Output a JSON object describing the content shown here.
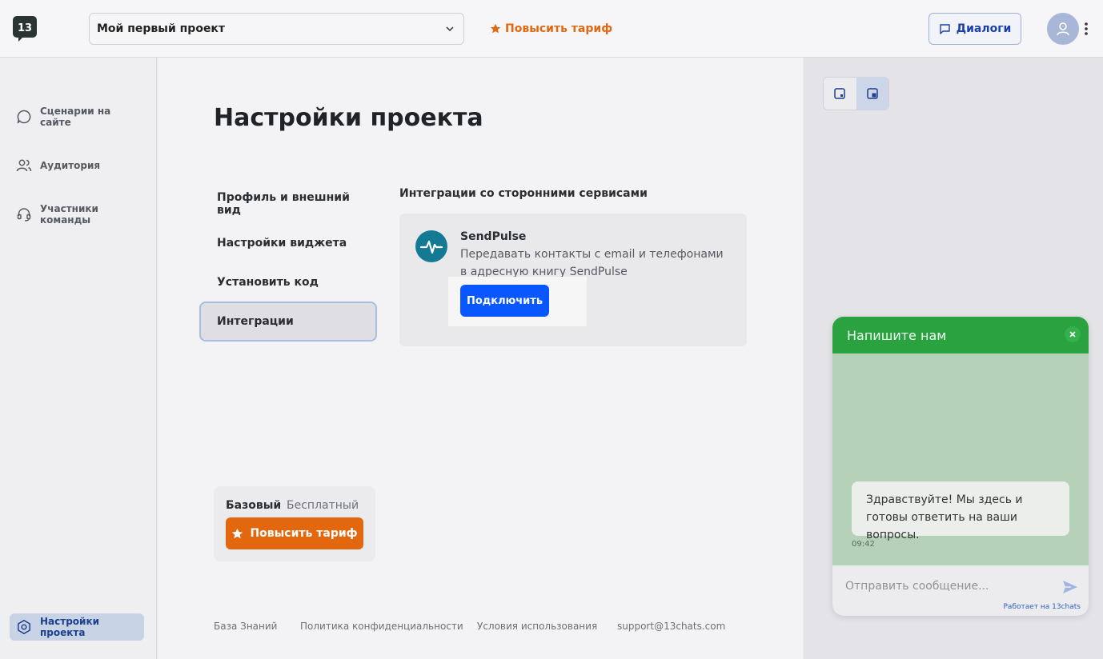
{
  "header": {
    "project_select": "Мой первый проект",
    "upgrade_link": "Повысить тариф",
    "dialogs_button": "Диалоги"
  },
  "sidebar": {
    "items": [
      {
        "label": "Сценарии на сайте",
        "icon": "chat-bubble-icon"
      },
      {
        "label": "Аудитория",
        "icon": "users-icon"
      },
      {
        "label": "Участники команды",
        "icon": "headset-icon"
      }
    ],
    "active_item": {
      "label": "Настройки проекта",
      "icon": "hexagon-settings-icon"
    }
  },
  "main": {
    "title": "Настройки проекта",
    "nav": [
      {
        "label": "Профиль и внешний вид"
      },
      {
        "label": "Настройки виджета"
      },
      {
        "label": "Установить код"
      },
      {
        "label": "Интеграции"
      }
    ],
    "section_title": "Интеграции со сторонними сервисами",
    "integration": {
      "name": "SendPulse",
      "description": "Передавать контакты с email и телефонами в адресную книгу SendPulse",
      "connect_button": "Подключить"
    },
    "plan": {
      "name": "Базовый",
      "type": "Бесплатный",
      "upgrade_button": "Повысить тариф"
    },
    "footer": [
      {
        "label": "База Знаний"
      },
      {
        "label": "Политика конфиденциальности"
      },
      {
        "label": "Условия использования"
      },
      {
        "label": "support@13chats.com"
      }
    ]
  },
  "widget": {
    "title": "Напишите нам",
    "greeting": "Здравствуйте! Мы здесь и готовы ответить на ваши вопросы.",
    "time": "09:42",
    "input_placeholder": "Отправить сообщение...",
    "powered_by": "Работает на 13chats"
  },
  "colors": {
    "accent_blue": "#0b57ff",
    "accent_orange": "#e2670f",
    "widget_green": "#2aa240"
  }
}
